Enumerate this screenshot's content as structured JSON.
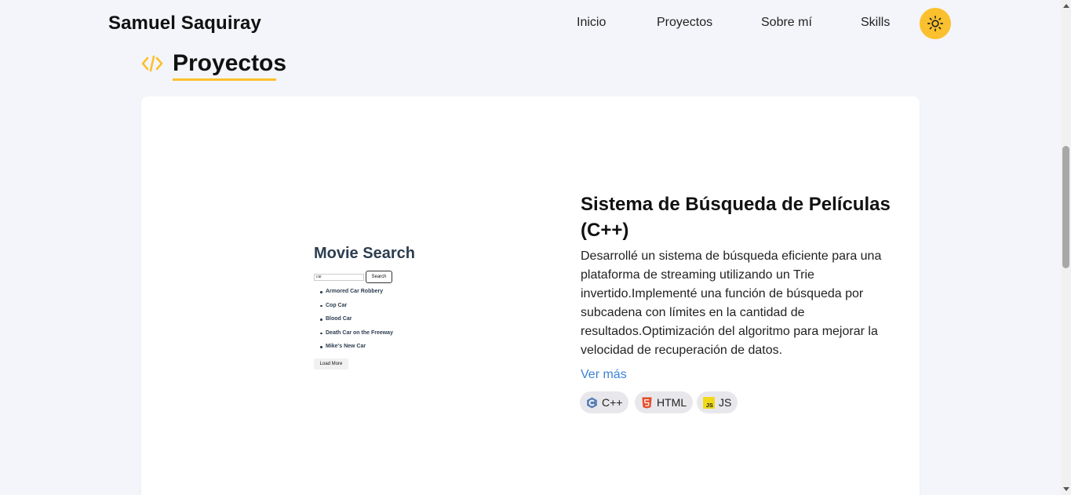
{
  "header": {
    "brand": "Samuel Saquiray",
    "nav": [
      "Inicio",
      "Proyectos",
      "Sobre mí",
      "Skills"
    ],
    "theme_toggle_icon": "sun-icon"
  },
  "section": {
    "icon": "code-icon",
    "title": "Proyectos",
    "accent_color": "#fbc02d"
  },
  "project": {
    "preview": {
      "title": "Movie Search",
      "input_value": "car",
      "search_button": "Search",
      "results": [
        "Armored Car Robbery",
        "Cop Car",
        "Blood Car",
        "Death Car on the Freeway",
        "Mike's New Car"
      ],
      "load_more": "Load More"
    },
    "title": "Sistema de Búsqueda de Películas (C++)",
    "description": "Desarrollé un sistema de búsqueda eficiente para una plataforma de streaming utilizando un Trie invertido.Implementé una función de búsqueda por subcadena con límites en la cantidad de resultados.Optimización del algoritmo para mejorar la velocidad de recuperación de datos.",
    "link": "Ver más",
    "link_color": "#3b82d6",
    "tags": [
      {
        "label": "C++",
        "icon": "cpp-icon"
      },
      {
        "label": "HTML",
        "icon": "html5-icon"
      },
      {
        "label": "JS",
        "icon": "js-icon"
      }
    ]
  }
}
